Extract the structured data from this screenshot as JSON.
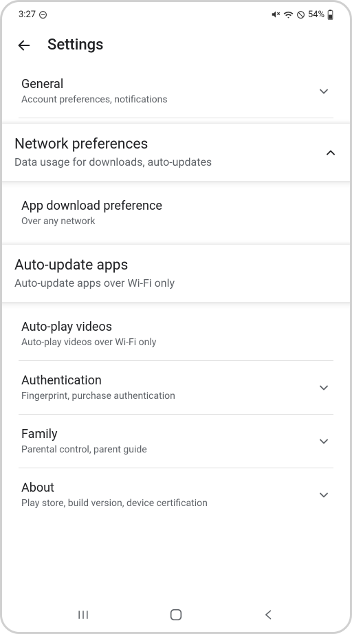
{
  "status": {
    "time": "3:27",
    "battery": "54%"
  },
  "header": {
    "title": "Settings"
  },
  "sections": {
    "general": {
      "title": "General",
      "subtitle": "Account preferences, notifications"
    },
    "network": {
      "title": "Network preferences",
      "subtitle": "Data usage for downloads, auto-updates"
    },
    "appDownload": {
      "title": "App download preference",
      "subtitle": "Over any network"
    },
    "autoUpdate": {
      "title": "Auto-update apps",
      "subtitle": "Auto-update apps over Wi-Fi only"
    },
    "autoPlay": {
      "title": "Auto-play videos",
      "subtitle": "Auto-play videos over Wi-Fi only"
    },
    "auth": {
      "title": "Authentication",
      "subtitle": "Fingerprint, purchase authentication"
    },
    "family": {
      "title": "Family",
      "subtitle": "Parental control, parent guide"
    },
    "about": {
      "title": "About",
      "subtitle": "Play store, build version, device certification"
    }
  }
}
